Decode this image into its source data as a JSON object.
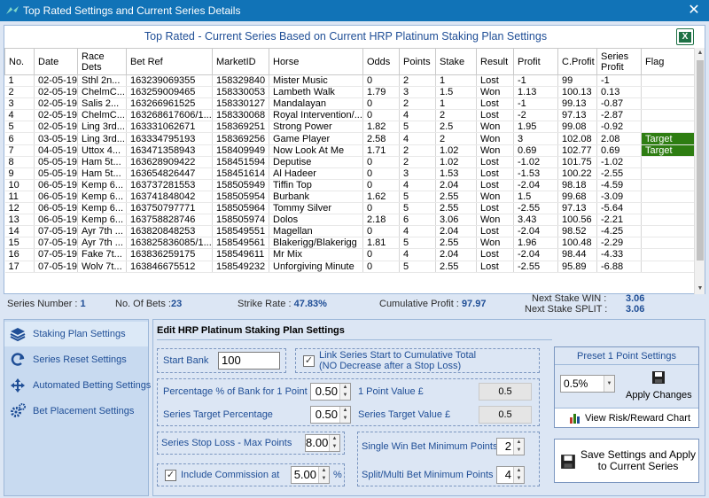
{
  "window": {
    "title": "Top Rated Settings and Current Series Details",
    "close_glyph": "✕"
  },
  "grid": {
    "title": "Top Rated - Current Series Based on Current HRP Platinum Staking Plan Settings",
    "columns": [
      "No.",
      "Date",
      "Race Dets",
      "Bet Ref",
      "MarketID",
      "Horse",
      "Odds",
      "Points",
      "Stake",
      "Result",
      "Profit",
      "C.Profit",
      "Series Profit",
      "Flag"
    ],
    "rows": [
      [
        "1",
        "02-05-19",
        "Sthl  2n...",
        "163239069355",
        "158329840",
        "Mister Music",
        "0",
        "2",
        "1",
        "Lost",
        "-1",
        "99",
        "-1",
        ""
      ],
      [
        "2",
        "02-05-19",
        "ChelmC...",
        "163259009465",
        "158330053",
        "Lambeth Walk",
        "1.79",
        "3",
        "1.5",
        "Won",
        "1.13",
        "100.13",
        "0.13",
        ""
      ],
      [
        "3",
        "02-05-19",
        "Salis  2...",
        "163266961525",
        "158330127",
        "Mandalayan",
        "0",
        "2",
        "1",
        "Lost",
        "-1",
        "99.13",
        "-0.87",
        ""
      ],
      [
        "4",
        "02-05-19",
        "ChelmC...",
        "163268617606/1...",
        "158330068",
        "Royal Intervention/...",
        "0",
        "4",
        "2",
        "Lost",
        "-2",
        "97.13",
        "-2.87",
        ""
      ],
      [
        "5",
        "02-05-19",
        "Ling 3rd...",
        "163331062671",
        "158369251",
        "Strong Power",
        "1.82",
        "5",
        "2.5",
        "Won",
        "1.95",
        "99.08",
        "-0.92",
        ""
      ],
      [
        "6",
        "03-05-19",
        "Ling 3rd...",
        "163334795193",
        "158369256",
        "Game Player",
        "2.58",
        "4",
        "2",
        "Won",
        "3",
        "102.08",
        "2.08",
        "Target"
      ],
      [
        "7",
        "04-05-19",
        "Uttox  4...",
        "163471358943",
        "158409949",
        "Now Look At Me",
        "1.71",
        "2",
        "1.02",
        "Won",
        "0.69",
        "102.77",
        "0.69",
        "Target"
      ],
      [
        "8",
        "05-05-19",
        "Ham  5t...",
        "163628909422",
        "158451594",
        "Deputise",
        "0",
        "2",
        "1.02",
        "Lost",
        "-1.02",
        "101.75",
        "-1.02",
        ""
      ],
      [
        "9",
        "05-05-19",
        "Ham  5t...",
        "163654826447",
        "158451614",
        "Al Hadeer",
        "0",
        "3",
        "1.53",
        "Lost",
        "-1.53",
        "100.22",
        "-2.55",
        ""
      ],
      [
        "10",
        "06-05-19",
        "Kemp 6...",
        "163737281553",
        "158505949",
        "Tiffin Top",
        "0",
        "4",
        "2.04",
        "Lost",
        "-2.04",
        "98.18",
        "-4.59",
        ""
      ],
      [
        "11",
        "06-05-19",
        "Kemp 6...",
        "163741848042",
        "158505954",
        "Burbank",
        "1.62",
        "5",
        "2.55",
        "Won",
        "1.5",
        "99.68",
        "-3.09",
        ""
      ],
      [
        "12",
        "06-05-19",
        "Kemp 6...",
        "163750797771",
        "158505964",
        "Tommy Silver",
        "0",
        "5",
        "2.55",
        "Lost",
        "-2.55",
        "97.13",
        "-5.64",
        ""
      ],
      [
        "13",
        "06-05-19",
        "Kemp 6...",
        "163758828746",
        "158505974",
        "Dolos",
        "2.18",
        "6",
        "3.06",
        "Won",
        "3.43",
        "100.56",
        "-2.21",
        ""
      ],
      [
        "14",
        "07-05-19",
        "Ayr 7th ...",
        "163820848253",
        "158549551",
        "Magellan",
        "0",
        "4",
        "2.04",
        "Lost",
        "-2.04",
        "98.52",
        "-4.25",
        ""
      ],
      [
        "15",
        "07-05-19",
        "Ayr 7th ...",
        "163825836085/1...",
        "158549561",
        "Blakerigg/Blakerigg",
        "1.81",
        "5",
        "2.55",
        "Won",
        "1.96",
        "100.48",
        "-2.29",
        ""
      ],
      [
        "16",
        "07-05-19",
        "Fake 7t...",
        "163836259175",
        "158549611",
        "Mr Mix",
        "0",
        "4",
        "2.04",
        "Lost",
        "-2.04",
        "98.44",
        "-4.33",
        ""
      ],
      [
        "17",
        "07-05-19",
        "Wolv 7t...",
        "163846675512",
        "158549232",
        "Unforgiving Minute",
        "0",
        "5",
        "2.55",
        "Lost",
        "-2.55",
        "95.89",
        "-6.88",
        ""
      ]
    ]
  },
  "status": {
    "series_number_label": "Series Number :",
    "series_number": "1",
    "no_of_bets_label": "No. Of Bets :",
    "no_of_bets": "23",
    "strike_rate_label": "Strike Rate :",
    "strike_rate": "47.83%",
    "cum_profit_label": "Cumulative Profit :",
    "cum_profit": "97.97",
    "next_win_label": "Next Stake WIN :",
    "next_win": "3.06",
    "next_split_label": "Next Stake SPLIT :",
    "next_split": "3.06"
  },
  "nav": [
    {
      "label": "Staking Plan Settings",
      "icon": "stack-icon"
    },
    {
      "label": "Series Reset Settings",
      "icon": "refresh-icon"
    },
    {
      "label": "Automated Betting Settings",
      "icon": "move-icon"
    },
    {
      "label": "Bet Placement Settings",
      "icon": "gears-icon"
    }
  ],
  "panel": {
    "title": "Edit HRP Platinum Staking Plan Settings",
    "start_bank_label": "Start Bank",
    "start_bank": "100",
    "link_series_label": "Link Series Start to Cumulative Total",
    "link_series_sub": "(NO Decrease after a Stop Loss)",
    "pct_bank_label": "Percentage % of Bank for 1 Point",
    "pct_bank": "0.50",
    "point_value_label": "1 Point Value £",
    "point_value": "0.5",
    "series_target_pct_label": "Series Target Percentage",
    "series_target_pct": "0.50",
    "series_target_value_label": "Series Target Value £",
    "series_target_value": "0.5",
    "stop_loss_label": "Series Stop Loss - Max Points",
    "stop_loss": "8.00",
    "single_win_label": "Single Win Bet Minimum Points",
    "single_win": "2",
    "split_label": "Split/Multi  Bet Minimum Points",
    "split": "4",
    "commission_label": "Include Commission at",
    "commission": "5.00",
    "commission_unit": "%",
    "preset_title": "Preset 1 Point Settings",
    "preset_value": "0.5%",
    "apply_label": "Apply Changes",
    "risk_label": "View Risk/Reward Chart",
    "save_label": "Save Settings and Apply to Current Series"
  }
}
